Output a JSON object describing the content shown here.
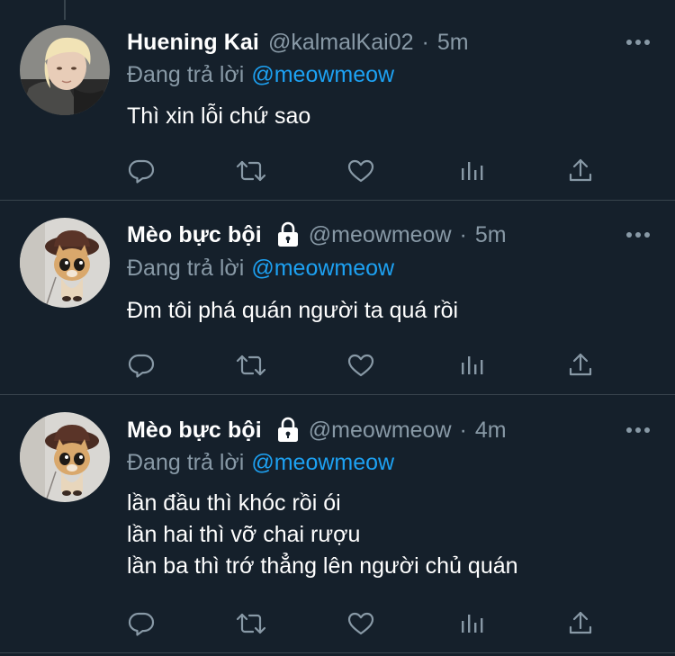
{
  "tweets": [
    {
      "display_name": "Huening Kai",
      "locked": false,
      "handle": "@kalmalKai02",
      "separator": "·",
      "time": "5m",
      "reply_prefix": "Đang trả lời",
      "reply_to": "@meowmeow",
      "text_lines": [
        "Thì xin lỗi chứ sao"
      ],
      "avatar": "person-photo"
    },
    {
      "display_name": "Mèo bực bội",
      "locked": true,
      "handle": "@meowmeow",
      "separator": "·",
      "time": "5m",
      "reply_prefix": "Đang trả lời",
      "reply_to": "@meowmeow",
      "text_lines": [
        "Đm tôi phá quán người ta quá rồi"
      ],
      "avatar": "cat-in-hat-photo"
    },
    {
      "display_name": "Mèo bực bội",
      "locked": true,
      "handle": "@meowmeow",
      "separator": "·",
      "time": "4m",
      "reply_prefix": "Đang trả lời",
      "reply_to": "@meowmeow",
      "text_lines": [
        "lần đầu thì khóc rồi ói",
        "lần hai thì vỡ chai rượu",
        "lần ba thì trớ thẳng lên người chủ quán"
      ],
      "avatar": "cat-in-hat-photo"
    }
  ],
  "action_icons": [
    "reply-icon",
    "retweet-icon",
    "like-icon",
    "analytics-icon",
    "share-icon"
  ],
  "colors": {
    "background": "#15202b",
    "divider": "#38444d",
    "secondary_text": "#8899a6",
    "accent": "#1da1f2",
    "primary_text": "#ffffff"
  }
}
